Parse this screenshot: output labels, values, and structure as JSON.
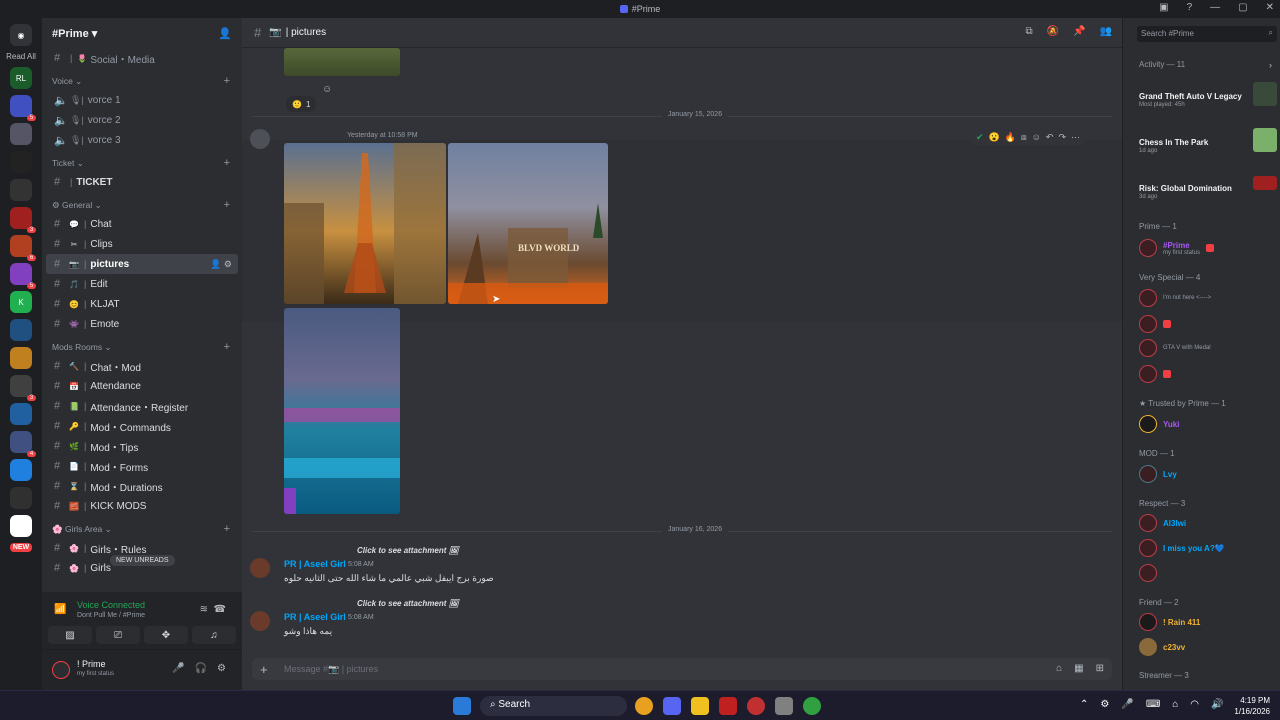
{
  "window": {
    "title": "#Prime"
  },
  "guilds": {
    "read_all": "Read All",
    "new_label": "NEW",
    "badges": [
      "5",
      "3",
      "6",
      "5",
      "3",
      "4"
    ]
  },
  "server": {
    "name": "#Prime"
  },
  "channels": {
    "top": [
      {
        "emoji": "🌷",
        "label": "Social・Media"
      }
    ],
    "voice_category": "Voice",
    "voice": [
      "vorce 1",
      "vorce 2",
      "vorce 3"
    ],
    "ticket_category": "Ticket",
    "ticket": [
      "TICKET"
    ],
    "general_category": "General",
    "general": [
      {
        "emoji": "💬",
        "label": "Chat"
      },
      {
        "emoji": "✂",
        "label": "Clips"
      },
      {
        "emoji": "📷",
        "label": "pictures"
      },
      {
        "emoji": "🎵",
        "label": "Edit"
      },
      {
        "emoji": "😊",
        "label": "KLJAT"
      },
      {
        "emoji": "👾",
        "label": "Emote"
      }
    ],
    "mods_category": "Mods Rooms",
    "mods": [
      {
        "emoji": "🔨",
        "label": "Chat・Mod"
      },
      {
        "emoji": "📅",
        "label": "Attendance"
      },
      {
        "emoji": "📗",
        "label": "Attendance・Register"
      },
      {
        "emoji": "🔑",
        "label": "Mod・Commands"
      },
      {
        "emoji": "🌿",
        "label": "Mod・Tips"
      },
      {
        "emoji": "📄",
        "label": "Mod・Forms"
      },
      {
        "emoji": "⌛",
        "label": "Mod・Durations"
      },
      {
        "emoji": "🧱",
        "label": "KICK MODS"
      }
    ],
    "girls_category": "Girls Area",
    "girls": [
      {
        "emoji": "🌸",
        "label": "Girls・Rules"
      },
      {
        "emoji": "🌸",
        "label": "Girls"
      }
    ],
    "new_unreads": "NEW UNREADS"
  },
  "voice_panel": {
    "status": "Voice Connected",
    "channel": "Dont Pull Me / #Prime"
  },
  "user_panel": {
    "name": "! Prime",
    "status": "my first status"
  },
  "chat": {
    "channel_name": "pictures",
    "reaction_count": "1",
    "date1": "January 15, 2026",
    "msg1_time": "Yesterday at 10:58 PM",
    "date2": "January 16, 2026",
    "attach_text": "Click to see attachment",
    "author": "PR | Aseel Girl",
    "author_time": "5:08 AM",
    "msg2_text": "صورة برج ايبفل شبي عالمي ما شاء الله حتى الثانيه حلوه",
    "msg3_text": "يمه هاذا وشو",
    "placeholder": "Message #📷 | pictures",
    "image_sign": "BLVD WORLD"
  },
  "rightbar": {
    "search_placeholder": "Search #Prime",
    "activity_head": "Activity — 11",
    "activities": [
      {
        "title": "Grand Theft Auto V Legacy",
        "sub": "Most played: 45h",
        "thumb_color": "#3a4a3a"
      },
      {
        "title": "Chess In The Park",
        "sub": "1d ago",
        "thumb_color": "#7ab06a"
      },
      {
        "title": "Risk: Global Domination",
        "sub": "3d ago",
        "thumb_color": "#a02020"
      }
    ],
    "groups": [
      {
        "head": "Prime — 1",
        "members": [
          {
            "name": "#Prime",
            "color": "#a758f5",
            "status": "my first status"
          }
        ]
      },
      {
        "head": "Very Special — 4",
        "members": [
          {
            "name": "",
            "color": "#f23f43",
            "status": "I'm not here <---->"
          },
          {
            "name": "",
            "color": "#f23f43",
            "status": ""
          },
          {
            "name": "",
            "color": "#f23f43",
            "status": "GTA V with Medal"
          },
          {
            "name": "",
            "color": "#f23f43",
            "status": ""
          }
        ]
      },
      {
        "head": "Trusted by Prime — 1",
        "members": [
          {
            "name": "Yuki",
            "color": "#a758f5",
            "status": ""
          }
        ]
      },
      {
        "head": "MOD — 1",
        "members": [
          {
            "name": "Lvy",
            "color": "#00a8fc",
            "status": ""
          }
        ]
      },
      {
        "head": "Respect — 3",
        "members": [
          {
            "name": "Al3lwi",
            "color": "#00a8fc",
            "status": ""
          },
          {
            "name": "I miss you A?💙",
            "color": "#00a8fc",
            "status": ""
          },
          {
            "name": "",
            "color": "#00a8fc",
            "status": ""
          }
        ]
      },
      {
        "head": "Friend — 2",
        "members": [
          {
            "name": "! Rain 411",
            "color": "#f0b232",
            "status": ""
          },
          {
            "name": "c23vv",
            "color": "#f0b232",
            "status": ""
          }
        ]
      },
      {
        "head": "Streamer — 3",
        "members": []
      }
    ]
  },
  "taskbar": {
    "search": "Search",
    "time": "4:19 PM",
    "date": "1/16/2026"
  }
}
